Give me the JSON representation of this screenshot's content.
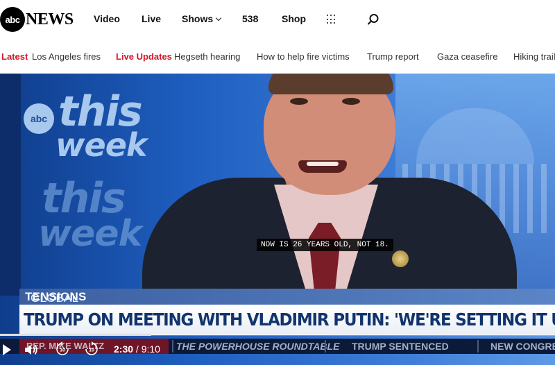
{
  "header": {
    "logo_abc": "abc",
    "logo_news": "NEWS",
    "nav": [
      {
        "label": "Video"
      },
      {
        "label": "Live"
      },
      {
        "label": "Shows"
      },
      {
        "label": "538"
      },
      {
        "label": "Shop"
      }
    ],
    "icons": {
      "apps": "grid-icon",
      "search": "search-icon"
    }
  },
  "trending": {
    "latest_label": "Latest",
    "latest_item": "Los Angeles fires",
    "live_label": "Live Updates",
    "live_item": "Hegseth hearing",
    "items": [
      "How to help fire victims",
      "Trump report",
      "Gaza ceasefire",
      "Hiking trail"
    ]
  },
  "video": {
    "show_brand_abc": "abc",
    "show_brand_this": "this",
    "show_brand_week": "week",
    "caption": "NOW IS 26 YEARS OLD, NOT 18.",
    "lower_third": {
      "category_a": "GLOBAL",
      "category_b": "TENSIONS",
      "headline": "TRUMP ON MEETING WITH VLADIMIR PUTIN: 'WE'RE SETTING IT UP'"
    },
    "ticker": {
      "name_fragment": "REP. MIKE WALTZ",
      "items": [
        "THE POWERHOUSE ROUNDTABLE",
        "TRUMP SENTENCED",
        "NEW CONGRE"
      ]
    },
    "player": {
      "current_time": "2:30",
      "duration": "/ 9:10",
      "progress": 0.273,
      "rewind_seconds": "10",
      "forward_seconds": "10"
    }
  },
  "colors": {
    "accent_red": "#d2162d",
    "lower_third_blue": "#11346e"
  }
}
